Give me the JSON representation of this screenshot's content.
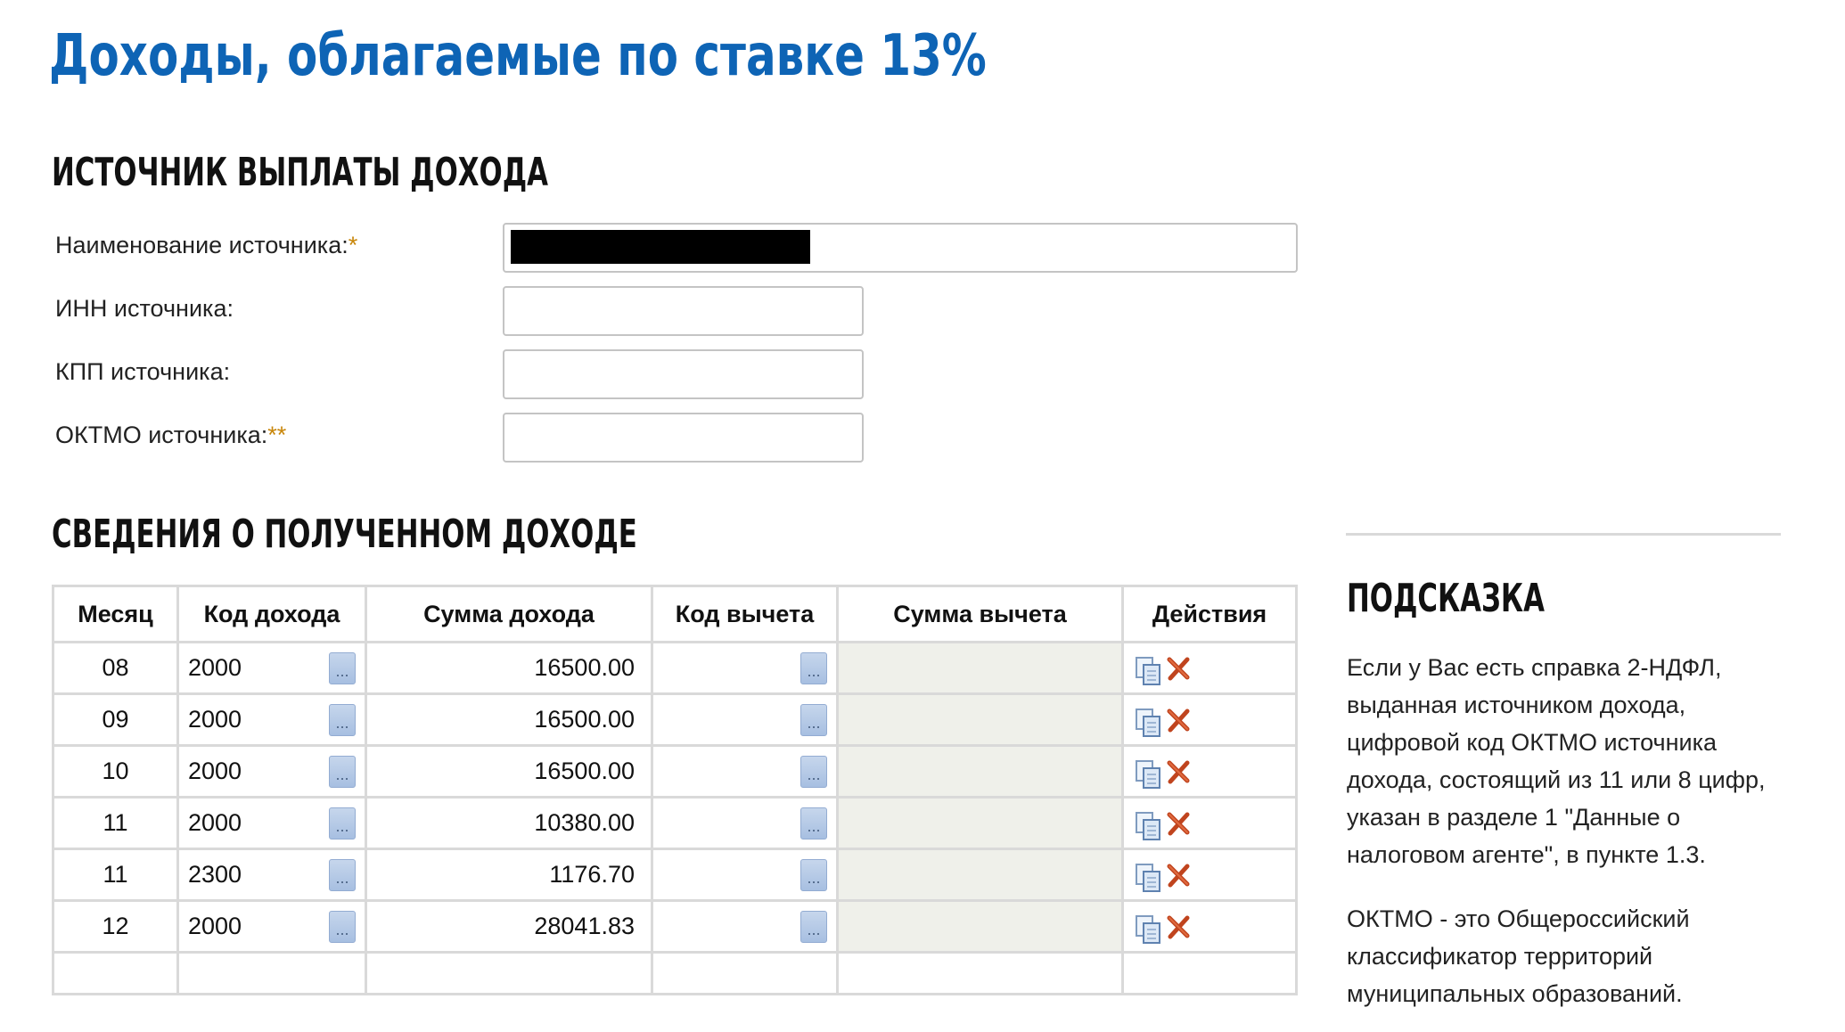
{
  "page": {
    "title": "Доходы, облагаемые по ставке 13%"
  },
  "source_section": {
    "heading": "Источник выплаты дохода",
    "fields": {
      "name": {
        "label": "Наименование источника:",
        "required_mark": "*",
        "value": ""
      },
      "inn": {
        "label": "ИНН источника:",
        "value": ""
      },
      "kpp": {
        "label": "КПП источника:",
        "value": ""
      },
      "oktmo": {
        "label": "ОКТМО источника:",
        "required_mark": "**",
        "value": ""
      }
    }
  },
  "income_section": {
    "heading": "Сведения о полученном доходе",
    "columns": [
      "Месяц",
      "Код дохода",
      "Сумма дохода",
      "Код вычета",
      "Сумма вычета",
      "Действия"
    ],
    "picker_glyph": "...",
    "rows": [
      {
        "month": "08",
        "code": "2000",
        "amount": "16500.00",
        "deduction_code": "",
        "deduction_amount": ""
      },
      {
        "month": "09",
        "code": "2000",
        "amount": "16500.00",
        "deduction_code": "",
        "deduction_amount": ""
      },
      {
        "month": "10",
        "code": "2000",
        "amount": "16500.00",
        "deduction_code": "",
        "deduction_amount": ""
      },
      {
        "month": "11",
        "code": "2000",
        "amount": "10380.00",
        "deduction_code": "",
        "deduction_amount": ""
      },
      {
        "month": "11",
        "code": "2300",
        "amount": "1176.70",
        "deduction_code": "",
        "deduction_amount": ""
      },
      {
        "month": "12",
        "code": "2000",
        "amount": "28041.83",
        "deduction_code": "",
        "deduction_amount": ""
      }
    ],
    "actions": {
      "copy_icon": "copy-icon",
      "delete_icon": "delete-icon"
    }
  },
  "hint": {
    "heading": "Подсказка",
    "paragraphs": [
      "Если у Вас есть справка 2-НДФЛ, выданная источником дохода, цифровой код ОКТМО источника дохода, состоящий из 11 или 8 цифр, указан в разделе 1 \"Данные о налоговом агенте\", в пункте 1.3.",
      "ОКТМО - это Общероссийский классификатор территорий муниципальных образований."
    ]
  },
  "colors": {
    "title": "#0e64b5",
    "required": "#c8860a",
    "disabled_cell": "#eff0ea",
    "delete": "#c0441e"
  }
}
